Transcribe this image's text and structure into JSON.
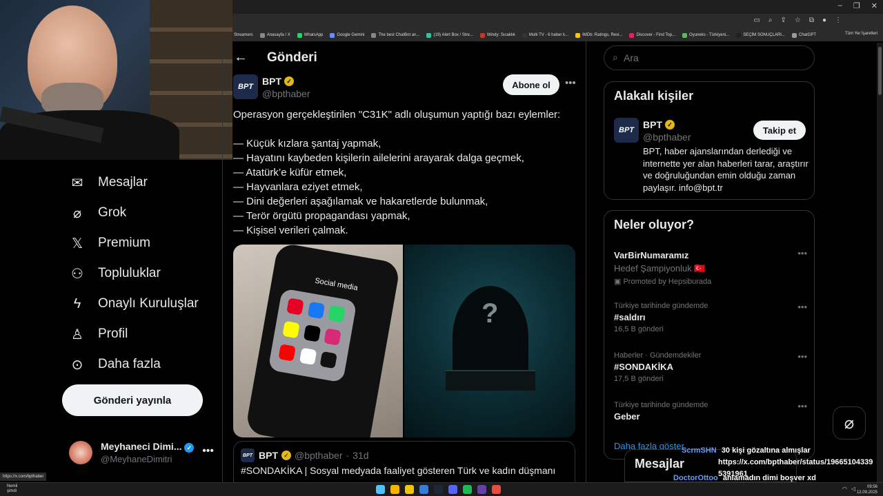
{
  "browser": {
    "bookmarks": [
      "Streamers",
      "Anasayfa / X",
      "WhatsApp",
      "Google Gemini",
      "The best ChatBot an...",
      "(19) Alert Box / Stre...",
      "Windy: Sıcaklık",
      "Multi TV - 6 haber k...",
      "IMDb: Ratings, Revi...",
      "Discover - Find Top...",
      "Oyuneks - Türkiyeni...",
      "SEÇİM SONUÇLARI...",
      "ChatGPT"
    ],
    "all_bookmarks": "Tüm Yer İşaretleri",
    "status_url": "https://x.com/bpthaber"
  },
  "nav": {
    "items": [
      {
        "label": "Mesajlar",
        "icon": "mail-icon"
      },
      {
        "label": "Grok",
        "icon": "grok-icon"
      },
      {
        "label": "Premium",
        "icon": "x-logo-icon"
      },
      {
        "label": "Topluluklar",
        "icon": "communities-icon"
      },
      {
        "label": "Onaylı Kuruluşlar",
        "icon": "lightning-icon"
      },
      {
        "label": "Profil",
        "icon": "profile-icon"
      },
      {
        "label": "Daha fazla",
        "icon": "more-circle-icon"
      }
    ],
    "post_button": "Gönderi yayınla",
    "account": {
      "name": "Meyhaneci Dimi...",
      "handle": "@MeyhaneDimitri"
    }
  },
  "post": {
    "page_title": "Gönderi",
    "author": {
      "name": "BPT",
      "handle": "@bpthaber",
      "avatar_text": "BPT"
    },
    "subscribe_label": "Abone ol",
    "lines": [
      "Operasyon gerçekleştirilen \"C31K\" adlı oluşumun yaptığı bazı eylemler:",
      "",
      "— Küçük kızlara şantaj yapmak,",
      "— Hayatını kaybeden kişilerin ailelerini arayarak dalga geçmek,",
      "— Atatürk’e küfür etmek,",
      "— Hayvanlara eziyet etmek,",
      "— Dini değerleri aşağılamak ve hakaretlerde bulunmak,",
      "— Terör örgütü propagandası yapmak,",
      "— Kişisel verileri çalmak."
    ],
    "image_label": "Social media",
    "quote": {
      "name": "BPT",
      "handle": "@bpthaber",
      "time": "31d",
      "text": "#SONDAKİKA | Sosyal medyada faaliyet gösteren Türk ve kadın düşmanı"
    }
  },
  "sidebar": {
    "search_placeholder": "Ara",
    "related": {
      "title": "Alakalı kişiler",
      "name": "BPT",
      "handle": "@bpthaber",
      "follow_label": "Takip et",
      "bio": "BPT, haber ajanslarından derlediği ve internette yer alan haberleri tarar, araştırır ve doğruluğundan emin olduğu zaman paylaşır. info@bpt.tr"
    },
    "trends": {
      "title": "Neler oluyor?",
      "items": [
        {
          "sub": "",
          "name": "VarBirNumaramız",
          "detail": "Hedef Şampiyonluk 🇹🇷",
          "promo": "Promoted by Hepsiburada"
        },
        {
          "sub": "Türkiye tarihinde gündemde",
          "name": "#saldırı",
          "count": "16,5 B gönderi"
        },
        {
          "sub": "Haberler · Gündemdekiler",
          "name": "#SONDAKİKA",
          "count": "17,5 B gönderi"
        },
        {
          "sub": "Türkiye tarihinde gündemde",
          "name": "Geber",
          "count": ""
        }
      ],
      "show_more": "Daha fazla göster"
    }
  },
  "messages_drawer": {
    "title": "Mesajlar"
  },
  "chat": [
    {
      "user": "ScrmSHN",
      "msg": "30 kişi gözaltına almışlar"
    },
    {
      "user": "",
      "msg": "https://x.com/bpthaber/status/19665104339"
    },
    {
      "user": "",
      "msg": "5391961"
    },
    {
      "user": "DoctorOttoo",
      "msg": "anlamadın dimi boşver xd"
    }
  ],
  "taskbar": {
    "weather_line1": "Nemli",
    "weather_line2": "şimdi",
    "time": "09:56",
    "date": "12.09.2025"
  },
  "colors": {
    "accent": "#1d9bf0",
    "gold_check": "#e2b719",
    "background": "#000000"
  }
}
